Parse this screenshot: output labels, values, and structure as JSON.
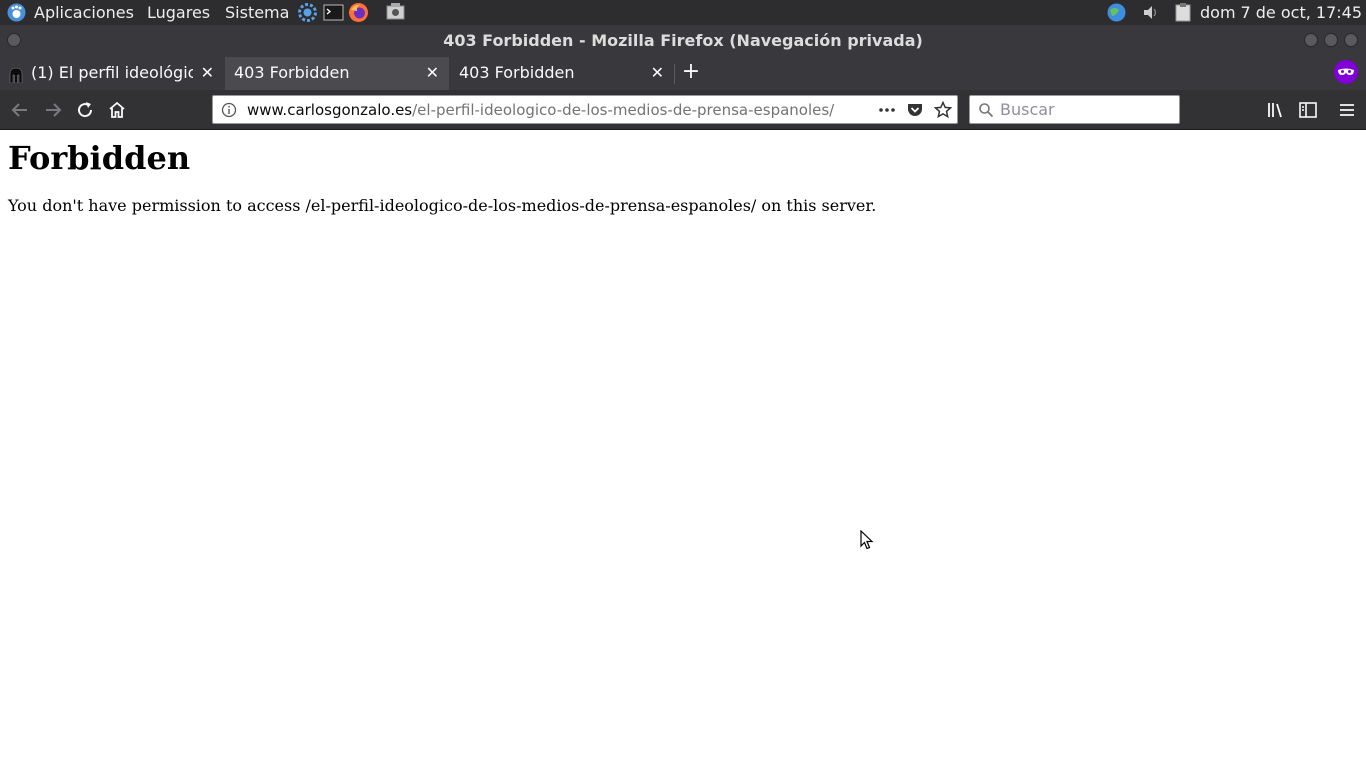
{
  "panel": {
    "menus": [
      "Aplicaciones",
      "Lugares",
      "Sistema"
    ],
    "day": "dom",
    "clock": "7 de oct, 17:45",
    "icons": [
      "gnome-foot-icon",
      "settings-gear-icon",
      "terminal-icon",
      "firefox-icon",
      "screenshot-icon",
      "network-icon",
      "volume-icon",
      "clipboard-icon"
    ]
  },
  "window": {
    "title": "403 Forbidden - Mozilla Firefox (Navegación privada)"
  },
  "tabs": [
    {
      "label": "(1) El perfil ideológic",
      "active": false
    },
    {
      "label": "403 Forbidden",
      "active": true
    },
    {
      "label": "403 Forbidden",
      "active": false
    }
  ],
  "navbar": {
    "url_domain": "www.carlosgonzalo.es",
    "url_path": "/el-perfil-ideologico-de-los-medios-de-prensa-espanoles/",
    "search_placeholder": "Buscar"
  },
  "page": {
    "heading": "Forbidden",
    "message": "You don't have permission to access /el-perfil-ideologico-de-los-medios-de-prensa-espanoles/ on this server."
  },
  "colors": {
    "panel_bg": "#2d2d2f",
    "chrome_bg": "#38383d",
    "active_tab_bg": "#4a4a4f",
    "private_badge": "#8000d7"
  }
}
